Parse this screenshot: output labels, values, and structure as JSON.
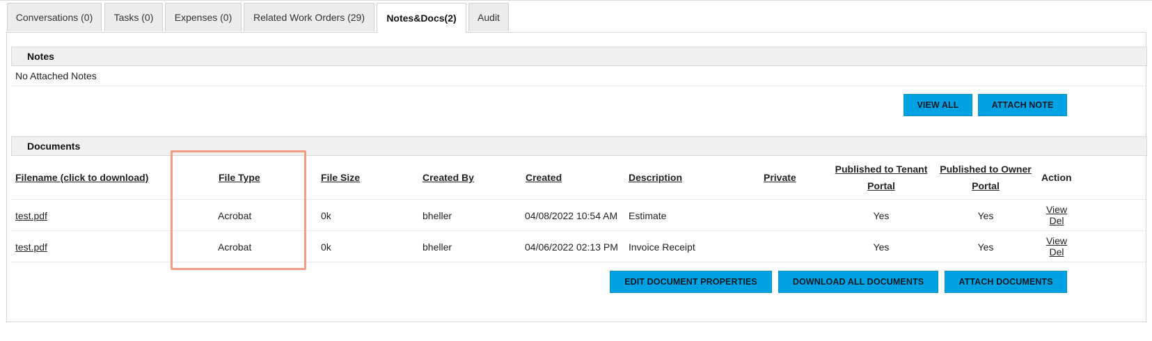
{
  "tabs": [
    {
      "label": "Conversations (0)"
    },
    {
      "label": "Tasks (0)"
    },
    {
      "label": "Expenses (0)"
    },
    {
      "label": "Related Work Orders (29)"
    },
    {
      "label": "Notes&Docs(2)",
      "active": true
    },
    {
      "label": "Audit"
    }
  ],
  "notes": {
    "title": "Notes",
    "empty_text": "No Attached Notes",
    "view_all_label": "VIEW ALL",
    "attach_note_label": "ATTACH NOTE"
  },
  "documents": {
    "title": "Documents",
    "columns": {
      "filename": "Filename (click to download)",
      "file_type": "File Type",
      "file_size": "File Size",
      "created_by": "Created By",
      "created": "Created",
      "description": "Description",
      "private": "Private",
      "published_tenant_line1": "Published to Tenant",
      "published_tenant_line2": "Portal",
      "published_owner_line1": "Published to Owner",
      "published_owner_line2": "Portal",
      "action": "Action"
    },
    "rows": [
      {
        "filename": "test.pdf",
        "file_type": "Acrobat",
        "file_size": "0k",
        "created_by": "bheller",
        "created": "04/08/2022 10:54 AM",
        "description": "Estimate",
        "private": "",
        "published_tenant": "Yes",
        "published_owner": "Yes",
        "action_view": "View",
        "action_del": "Del"
      },
      {
        "filename": "test.pdf",
        "file_type": "Acrobat",
        "file_size": "0k",
        "created_by": "bheller",
        "created": "04/06/2022 02:13 PM",
        "description": "Invoice Receipt",
        "private": "",
        "published_tenant": "Yes",
        "published_owner": "Yes",
        "action_view": "View",
        "action_del": "Del"
      }
    ],
    "edit_properties_label": "EDIT DOCUMENT PROPERTIES",
    "download_all_label": "DOWNLOAD ALL DOCUMENTS",
    "attach_documents_label": "ATTACH DOCUMENTS"
  },
  "colors": {
    "button_bg": "#00a2e3",
    "highlight_border": "#f49c86",
    "section_bar_bg": "#f0f0f0"
  }
}
